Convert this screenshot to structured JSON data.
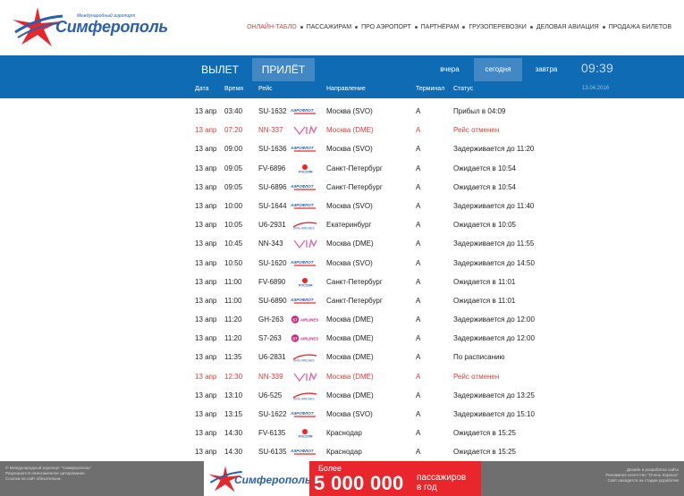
{
  "header": {
    "logo_small": "Международный аэропорт",
    "logo_name": "Симферополь",
    "nav": [
      {
        "label": "Онлайн-табло",
        "active": true
      },
      {
        "label": "Пассажирам",
        "active": false
      },
      {
        "label": "Про аэропорт",
        "active": false
      },
      {
        "label": "Партнёрам",
        "active": false
      },
      {
        "label": "Грузоперевозки",
        "active": false
      },
      {
        "label": "Деловая авиация",
        "active": false
      },
      {
        "label": "Продажа билетов",
        "active": false
      }
    ]
  },
  "board": {
    "tab_departure": "ВЫЛЕТ",
    "tab_arrival": "ПРИЛЁТ",
    "day_yesterday": "вчера",
    "day_today": "сегодня",
    "day_tomorrow": "завтра",
    "clock": "09:39",
    "date": "13.04.2016",
    "columns": {
      "date": "Дата",
      "time": "Время",
      "flight": "Рейс",
      "direction": "Направление",
      "terminal": "Терминал",
      "status": "Статус"
    }
  },
  "flights": [
    {
      "date": "13 апр",
      "time": "03:40",
      "flight": "SU-1632",
      "airline": "aeroflot",
      "direction": "Москва (SVO)",
      "terminal": "A",
      "status": "Прибыл в 04:09",
      "cancelled": false
    },
    {
      "date": "13 апр",
      "time": "07:20",
      "flight": "NN-337",
      "airline": "vim",
      "direction": "Москва (DME)",
      "terminal": "A",
      "status": "Рейс отменен",
      "cancelled": true
    },
    {
      "date": "13 апр",
      "time": "09:00",
      "flight": "SU-1636",
      "airline": "aeroflot",
      "direction": "Москва (SVO)",
      "terminal": "A",
      "status": "Задерживается до 11:20",
      "cancelled": false
    },
    {
      "date": "13 апр",
      "time": "09:05",
      "flight": "FV-6896",
      "airline": "rossiya",
      "direction": "Санкт-Петербург",
      "terminal": "A",
      "status": "Ожидается в 10:54",
      "cancelled": false
    },
    {
      "date": "13 апр",
      "time": "09:05",
      "flight": "SU-6896",
      "airline": "aeroflot",
      "direction": "Санкт-Петербург",
      "terminal": "A",
      "status": "Ожидается в 10:54",
      "cancelled": false
    },
    {
      "date": "13 апр",
      "time": "10:00",
      "flight": "SU-1644",
      "airline": "aeroflot",
      "direction": "Москва (SVO)",
      "terminal": "A",
      "status": "Задерживается до 11:40",
      "cancelled": false
    },
    {
      "date": "13 апр",
      "time": "10:05",
      "flight": "U6-2931",
      "airline": "ural",
      "direction": "Екатеринбург",
      "terminal": "A",
      "status": "Ожидается в 10:05",
      "cancelled": false
    },
    {
      "date": "13 апр",
      "time": "10:45",
      "flight": "NN-343",
      "airline": "vim",
      "direction": "Москва (DME)",
      "terminal": "A",
      "status": "Задерживается до 11:55",
      "cancelled": false
    },
    {
      "date": "13 апр",
      "time": "10:50",
      "flight": "SU-1620",
      "airline": "aeroflot",
      "direction": "Москва (SVO)",
      "terminal": "A",
      "status": "Задерживается до 14:50",
      "cancelled": false
    },
    {
      "date": "13 апр",
      "time": "11:00",
      "flight": "FV-6890",
      "airline": "rossiya",
      "direction": "Санкт-Петербург",
      "terminal": "A",
      "status": "Ожидается в 11:01",
      "cancelled": false
    },
    {
      "date": "13 апр",
      "time": "11:00",
      "flight": "SU-6890",
      "airline": "aeroflot",
      "direction": "Санкт-Петербург",
      "terminal": "A",
      "status": "Ожидается в 11:01",
      "cancelled": false
    },
    {
      "date": "13 апр",
      "time": "11:20",
      "flight": "GH-263",
      "airline": "s7",
      "direction": "Москва (DME)",
      "terminal": "A",
      "status": "Задерживается до 12:00",
      "cancelled": false
    },
    {
      "date": "13 апр",
      "time": "11:20",
      "flight": "S7-263",
      "airline": "s7",
      "direction": "Москва (DME)",
      "terminal": "A",
      "status": "Задерживается до 12:00",
      "cancelled": false
    },
    {
      "date": "13 апр",
      "time": "11:35",
      "flight": "U6-2831",
      "airline": "ural",
      "direction": "Москва (DME)",
      "terminal": "A",
      "status": "По расписанию",
      "cancelled": false
    },
    {
      "date": "13 апр",
      "time": "12:30",
      "flight": "NN-339",
      "airline": "vim",
      "direction": "Москва (DME)",
      "terminal": "A",
      "status": "Рейс отменен",
      "cancelled": true
    },
    {
      "date": "13 апр",
      "time": "13:10",
      "flight": "U6-525",
      "airline": "ural",
      "direction": "Москва (DME)",
      "terminal": "A",
      "status": "Задерживается до 13:25",
      "cancelled": false
    },
    {
      "date": "13 апр",
      "time": "13:15",
      "flight": "SU-1622",
      "airline": "aeroflot",
      "direction": "Москва (SVO)",
      "terminal": "A",
      "status": "Задерживается до 15:10",
      "cancelled": false
    },
    {
      "date": "13 апр",
      "time": "14:30",
      "flight": "FV-6135",
      "airline": "rossiya",
      "direction": "Краснодар",
      "terminal": "A",
      "status": "Ожидается в 15:25",
      "cancelled": false
    },
    {
      "date": "13 апр",
      "time": "14:30",
      "flight": "SU-6135",
      "airline": "aeroflot",
      "direction": "Краснодар",
      "terminal": "A",
      "status": "Ожидается в 15:25",
      "cancelled": false
    }
  ],
  "footer": {
    "left_1": "© Международный аэропорт \"Симферополь\"",
    "left_2": "Разрешается неискаженное цитирование.",
    "left_3": "Ссылка на сайт обязательна.",
    "right_1": "Дизайн и разработка сайта",
    "right_2": "Рекламное агентство \"Очень Хорошо\"",
    "right_3": "Сайт находится на стадии доработки"
  },
  "banner": {
    "logo_name": "Симферополь",
    "more": "Более",
    "number": "5 000 000",
    "passengers_1": "пассажиров",
    "passengers_2": "в год"
  },
  "colors": {
    "brand_blue": "#0f6bb3",
    "active_tab": "#4188c5",
    "cancelled": "#e0403a",
    "banner_red": "#e8262b"
  }
}
